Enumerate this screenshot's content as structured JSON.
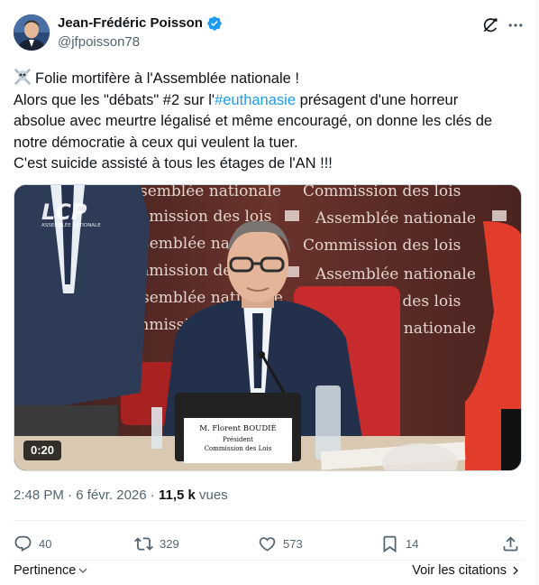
{
  "author": {
    "display_name": "Jean-Frédéric Poisson",
    "handle": "@jfpoisson78",
    "verified": true
  },
  "tweet": {
    "line1": "Folie mortifère à l'Assemblée nationale !",
    "line2_before": "Alors que les \"débats\" #2 sur l'",
    "hashtag": "#euthanasie",
    "line2_after": " présagent d'une horreur",
    "line3": "absolue avec meurtre légalisé et même encouragé, on donne les clés de",
    "line4": "notre démocratie à ceux qui veulent la tuer.",
    "line5": "C'est suicide assisté à tous les étages de l'AN !!!",
    "leading_icon": "skull-crossbones-icon"
  },
  "media": {
    "duration": "0:20",
    "backdrop_text_a": "Assemblée nationale",
    "backdrop_text_b": "Commission des lois",
    "channel_logo": "LCP",
    "channel_sub": "ASSEMBLÉE NATIONALE",
    "nameplate_name": "M. Florent BOUDIÉ",
    "nameplate_role1": "Président",
    "nameplate_role2": "Commission des Lois"
  },
  "meta": {
    "time": "2:48 PM",
    "separator": "·",
    "date": "6 févr. 2026",
    "views_count": "11,5 k",
    "views_label": "vues"
  },
  "actions": {
    "replies": "40",
    "reposts": "329",
    "likes": "573",
    "bookmarks": "14"
  },
  "footer": {
    "sort_label": "Pertinence",
    "quotes_label": "Voir les citations"
  },
  "colors": {
    "accent": "#1d9bf0",
    "text": "#0f1419",
    "muted": "#536471",
    "border": "#eff3f4"
  }
}
